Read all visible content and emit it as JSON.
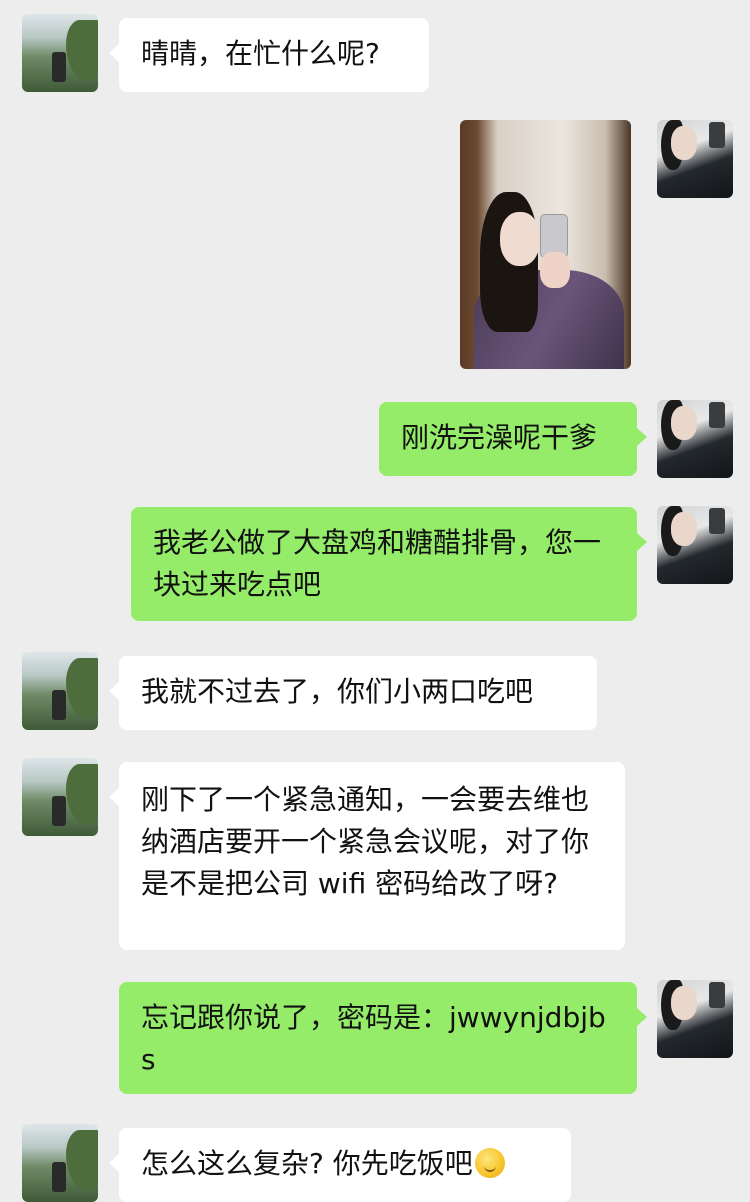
{
  "messages": [
    {
      "side": "left",
      "text": "晴晴，在忙什么呢?"
    },
    {
      "side": "right",
      "type": "image"
    },
    {
      "side": "right",
      "text": "刚洗完澡呢干爹"
    },
    {
      "side": "right",
      "text": "我老公做了大盘鸡和糖醋排骨，您一块过来吃点吧"
    },
    {
      "side": "left",
      "text": "我就不过去了，你们小两口吃吧"
    },
    {
      "side": "left",
      "text": "刚下了一个紧急通知，一会要去维也纳酒店要开一个紧急会议呢，对了你是不是把公司 wifi 密码给改了呀?"
    },
    {
      "side": "right",
      "text": "忘记跟你说了，密码是：jwwynjdbjbs"
    },
    {
      "side": "left",
      "text": "怎么这么复杂? 你先吃饭吧",
      "emoji": "thinking-face-icon"
    }
  ],
  "colors": {
    "background": "#ededed",
    "incoming_bubble": "#ffffff",
    "outgoing_bubble": "#95ec69",
    "text": "#111111"
  }
}
